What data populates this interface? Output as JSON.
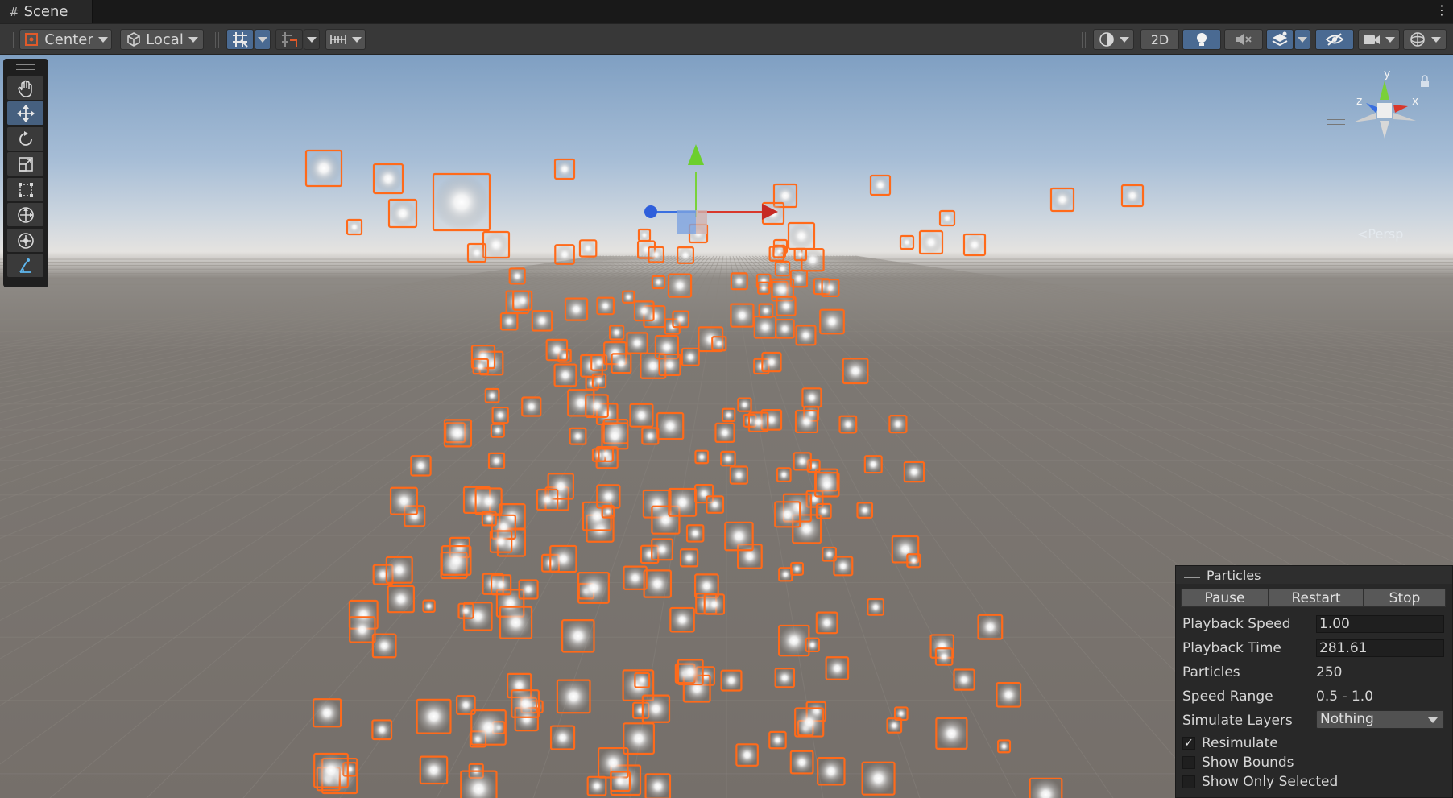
{
  "tab": {
    "icon": "grid-hash-icon",
    "title": "Scene",
    "menu_icon": "kebab-menu-icon"
  },
  "toolbar": {
    "pivot_mode": "Center",
    "pivot_rotation": "Local",
    "grid_snapping_icon": "grid-snap-icon",
    "increment_snap_icon": "increment-snap-icon",
    "ruler_icon": "ruler-icon",
    "shading_icon": "shading-mode-icon",
    "mode_2d_label": "2D",
    "lighting_icon": "lightbulb-icon",
    "audio_icon": "audio-mute-icon",
    "effects_icon": "effects-layers-icon",
    "visibility_icon": "hidden-objects-icon",
    "camera_icon": "scene-camera-icon",
    "gizmos_icon": "gizmos-icon"
  },
  "tools": [
    {
      "name": "hand-tool",
      "icon": "hand-icon",
      "active": false
    },
    {
      "name": "move-tool",
      "icon": "move-arrows-icon",
      "active": true
    },
    {
      "name": "rotate-tool",
      "icon": "rotate-icon",
      "active": false
    },
    {
      "name": "scale-tool",
      "icon": "scale-icon",
      "active": false
    },
    {
      "name": "rect-tool",
      "icon": "rect-transform-icon",
      "active": false
    },
    {
      "name": "transform-tool",
      "icon": "transform-icon",
      "active": false
    },
    {
      "name": "custom-tool",
      "icon": "custom-editor-tool-icon",
      "active": false
    },
    {
      "name": "shape-tool",
      "icon": "shape-edit-icon",
      "active": false
    }
  ],
  "scene_gizmo": {
    "axis_y": "y",
    "axis_x": "x",
    "axis_z": "z",
    "projection": "<Persp"
  },
  "colors": {
    "selection_outline": "#ff6a1a",
    "axis_x": "#d8382c",
    "axis_y": "#7ad03a",
    "axis_z": "#3a6fe0",
    "active_tool": "#46607f"
  },
  "particles_overlay": {
    "title": "Particles",
    "buttons": {
      "pause": "Pause",
      "restart": "Restart",
      "stop": "Stop"
    },
    "playback_speed_label": "Playback Speed",
    "playback_speed_value": "1.00",
    "playback_time_label": "Playback Time",
    "playback_time_value": "281.61",
    "particles_label": "Particles",
    "particles_value": "250",
    "speed_range_label": "Speed Range",
    "speed_range_value": "0.5 - 1.0",
    "simulate_layers_label": "Simulate Layers",
    "simulate_layers_value": "Nothing",
    "resimulate_label": "Resimulate",
    "resimulate_checked": true,
    "show_bounds_label": "Show Bounds",
    "show_bounds_checked": false,
    "show_only_selected_label": "Show Only Selected",
    "show_only_selected_checked": false
  }
}
